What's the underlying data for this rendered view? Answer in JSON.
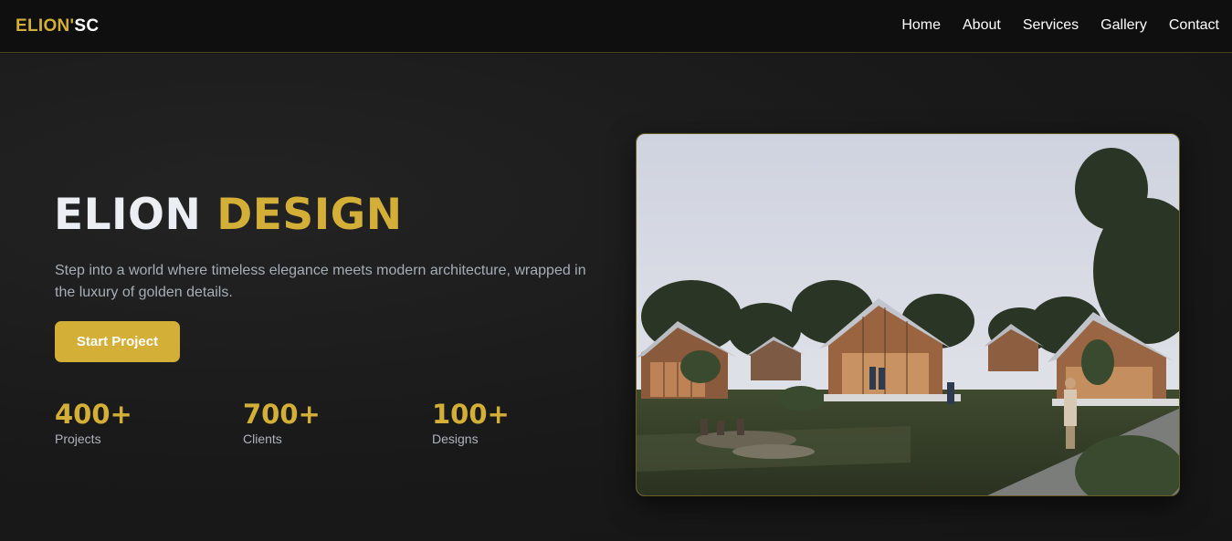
{
  "nav": {
    "logo_part1": "ELION'",
    "logo_part2": "SC",
    "links": [
      "Home",
      "About",
      "Services",
      "Gallery",
      "Contact"
    ]
  },
  "hero": {
    "title_part1": "ELION",
    "title_part2": "DESIGN",
    "subtitle": "Step into a world where timeless elegance meets modern architecture, wrapped in the luxury of golden details.",
    "cta_label": "Start Project",
    "stats": [
      {
        "value": "400+",
        "label": "Projects"
      },
      {
        "value": "700+",
        "label": "Clients"
      },
      {
        "value": "100+",
        "label": "Designs"
      }
    ]
  },
  "colors": {
    "accent": "#d4af37",
    "background": "#161616",
    "nav_background": "#0f0f0f"
  },
  "image": {
    "subject": "architectural render of gabled cabins among trees"
  }
}
